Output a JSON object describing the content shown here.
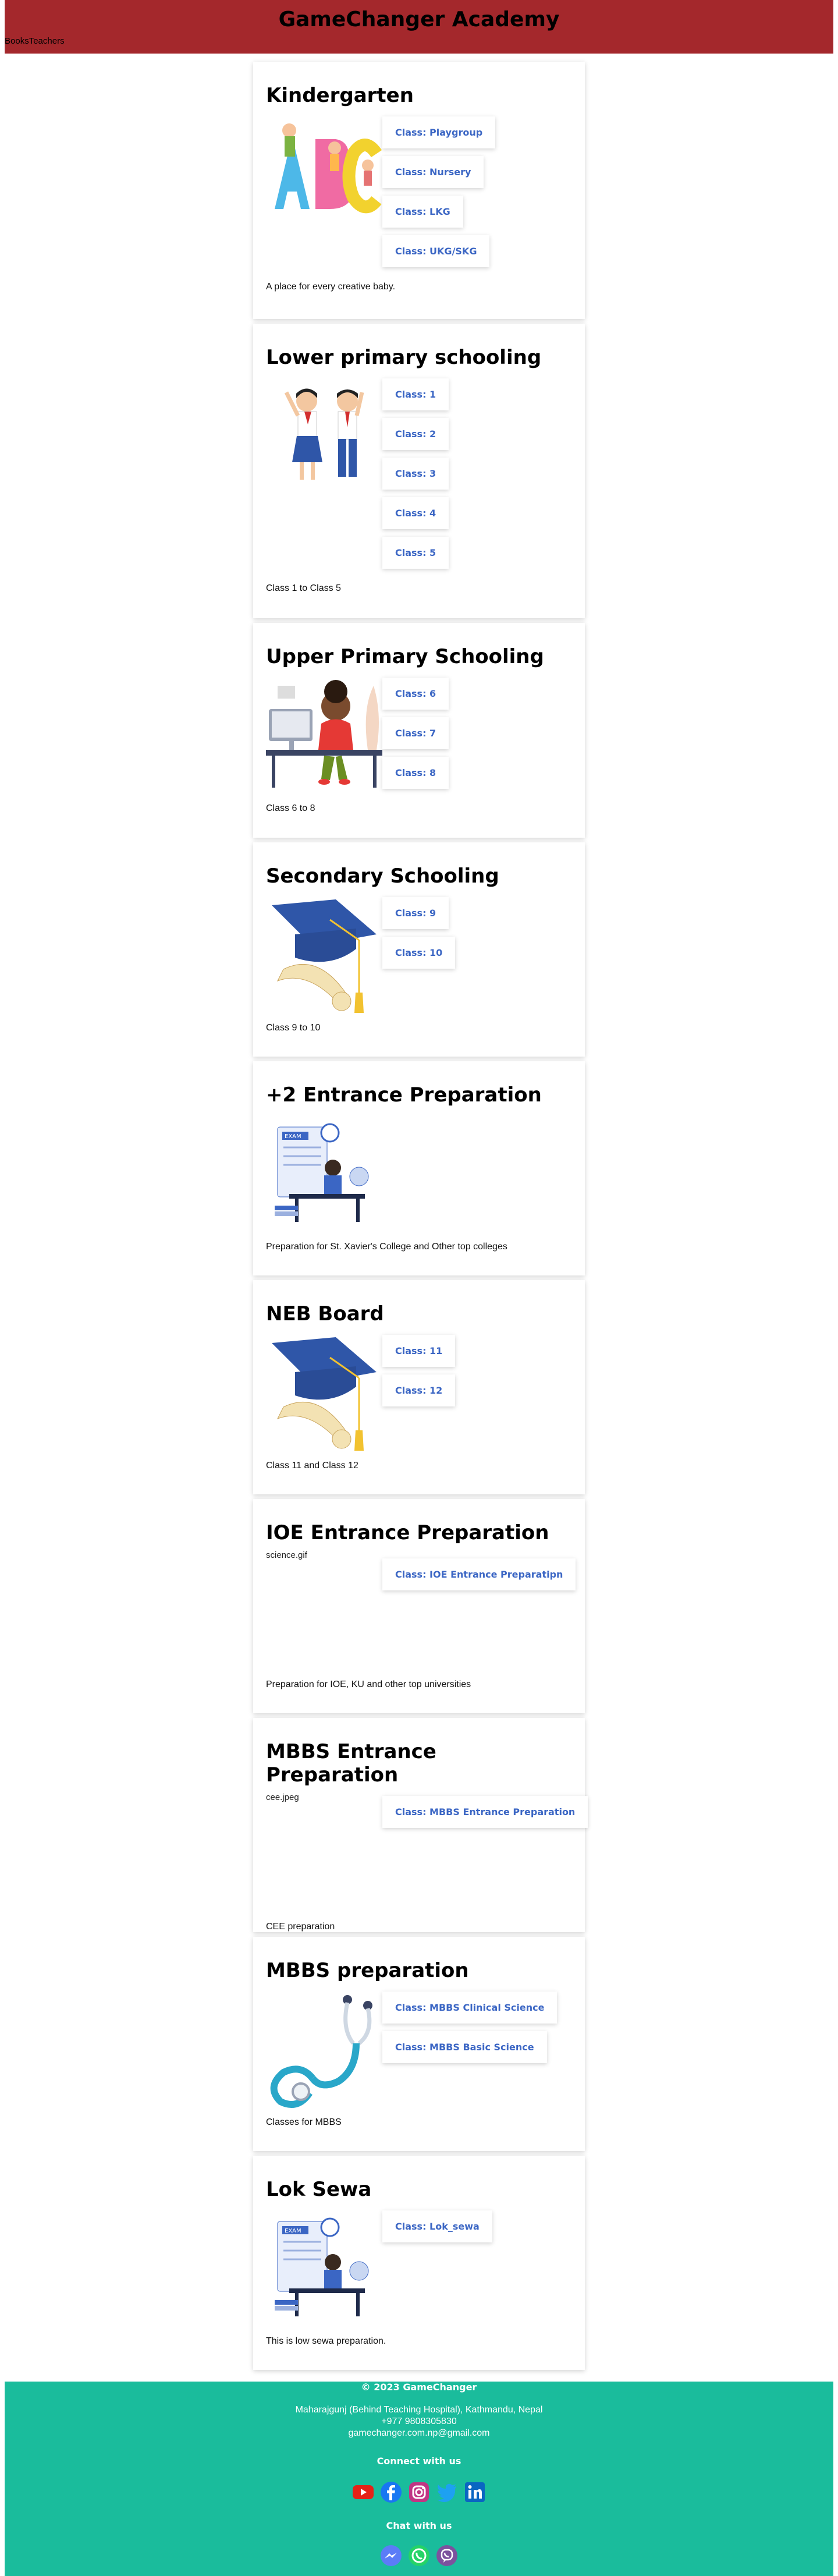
{
  "site": {
    "title": "GameChanger Academy",
    "nav": [
      {
        "label": "Books"
      },
      {
        "label": "Teachers"
      }
    ]
  },
  "courses": [
    {
      "title": "Kindergarten",
      "image": "abc-letters",
      "classes": [
        "Class: Playgroup",
        "Class: Nursery",
        "Class: LKG",
        "Class: UKG/SKG"
      ],
      "description": "A place for every creative baby."
    },
    {
      "title": "Lower primary schooling",
      "image": "students-waving",
      "classes": [
        "Class: 1",
        "Class: 2",
        "Class: 3",
        "Class: 4",
        "Class: 5"
      ],
      "description": "Class 1 to Class 5"
    },
    {
      "title": "Upper Primary Schooling",
      "image": "boy-at-desk",
      "classes": [
        "Class: 6",
        "Class: 7",
        "Class: 8"
      ],
      "description": "Class 6 to 8"
    },
    {
      "title": "Secondary Schooling",
      "image": "graduation-cap",
      "classes": [
        "Class: 9",
        "Class: 10"
      ],
      "description": "Class 9 to 10"
    },
    {
      "title": "+2 Entrance Preparation",
      "image": "exam-illustration",
      "classes": [],
      "description": "Preparation for St. Xavier's College and Other top colleges"
    },
    {
      "title": "NEB Board",
      "image": "graduation-cap",
      "classes": [
        "Class: 11",
        "Class: 12"
      ],
      "description": "Class 11 and Class 12"
    },
    {
      "title": "IOE Entrance Preparation",
      "image": "broken",
      "image_alt": "science.gif",
      "classes": [
        "Class: IOE Entrance Preparatipn"
      ],
      "description": "Preparation for IOE, KU and other top universities"
    },
    {
      "title": "MBBS Entrance Preparation",
      "image": "broken",
      "image_alt": "cee.jpeg",
      "classes": [
        "Class: MBBS Entrance Preparation"
      ],
      "description": "CEE preparation"
    },
    {
      "title": "MBBS preparation",
      "image": "stethoscope",
      "classes": [
        "Class: MBBS Clinical Science",
        "Class: MBBS Basic Science"
      ],
      "description": "Classes for MBBS"
    },
    {
      "title": "Lok Sewa",
      "image": "exam-illustration",
      "classes": [
        "Class: Lok_sewa"
      ],
      "description": "This is low sewa preparation."
    }
  ],
  "footer": {
    "copyright": "© 2023 GameChanger",
    "address": "Maharajgunj (Behind Teaching Hospital), Kathmandu, Nepal",
    "phone": "+977 9808305830",
    "email": "gamechanger.com.np@gmail.com",
    "connect_heading": "Connect with us",
    "chat_heading": "Chat with us",
    "social_icons": [
      "youtube-icon",
      "facebook-icon",
      "instagram-icon",
      "twitter-icon",
      "linkedin-icon"
    ],
    "chat_icons": [
      "messenger-icon",
      "whatsapp-icon",
      "viber-icon"
    ]
  },
  "colors": {
    "header_bg": "#a4282c",
    "footer_bg": "#1abc9c",
    "link": "#3b66c4"
  }
}
